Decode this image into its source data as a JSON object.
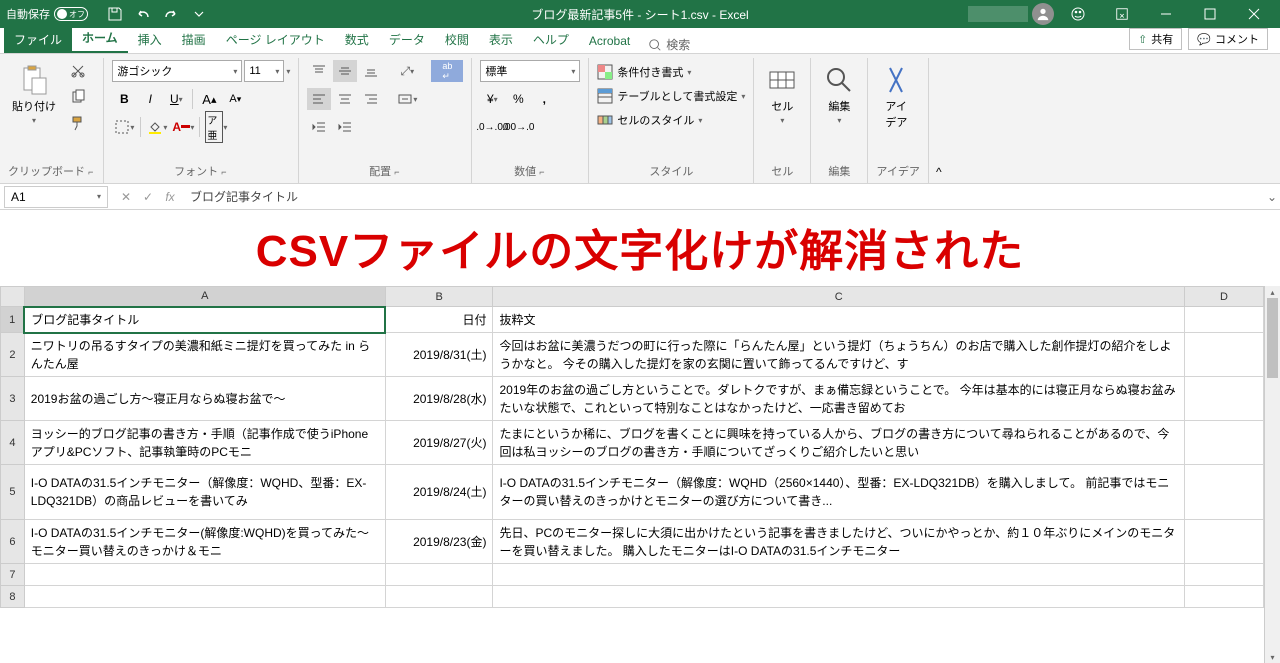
{
  "titlebar": {
    "autosave_label": "自動保存",
    "autosave_state": "オフ",
    "title": "ブログ最新記事5件 - シート1.csv - Excel"
  },
  "tabs": {
    "file": "ファイル",
    "home": "ホーム",
    "insert": "挿入",
    "draw": "描画",
    "pagelayout": "ページ レイアウト",
    "formulas": "数式",
    "data": "データ",
    "review": "校閲",
    "view": "表示",
    "help": "ヘルプ",
    "acrobat": "Acrobat",
    "tellme": "検索",
    "share": "共有",
    "comments": "コメント"
  },
  "ribbon": {
    "clipboard": {
      "paste": "貼り付け",
      "label": "クリップボード"
    },
    "font": {
      "name": "游ゴシック",
      "size": "11",
      "label": "フォント",
      "bold": "B",
      "italic": "I",
      "underline": "U"
    },
    "alignment": {
      "label": "配置"
    },
    "number": {
      "format": "標準",
      "label": "数値"
    },
    "styles": {
      "conditional": "条件付き書式",
      "table": "テーブルとして書式設定",
      "cell": "セルのスタイル",
      "label": "スタイル"
    },
    "cells": {
      "cell": "セル",
      "label": "セル"
    },
    "editing": {
      "edit": "編集",
      "label": "編集"
    },
    "ideas": {
      "ideas": "アイ\nデア",
      "label": "アイデア"
    }
  },
  "namebox": {
    "ref": "A1",
    "formula": "ブログ記事タイトル"
  },
  "overlay": "CSVファイルの文字化けが解消された",
  "columns": [
    "A",
    "B",
    "C",
    "D"
  ],
  "rows": [
    {
      "n": 1,
      "A": "ブログ記事タイトル",
      "B": "日付",
      "C": "抜粋文"
    },
    {
      "n": 2,
      "A": "ニワトリの吊るすタイプの美濃和紙ミニ提灯を買ってみた in らんたん屋",
      "B": "2019/8/31(土)",
      "C": "今回はお盆に美濃うだつの町に行った際に「らんたん屋」という提灯（ちょうちん）のお店で購入した創作提灯の紹介をしようかなと。 今その購入した提灯を家の玄関に置いて飾ってるんですけど、す"
    },
    {
      "n": 3,
      "A": "2019お盆の過ごし方～寝正月ならぬ寝お盆で～",
      "B": "2019/8/28(水)",
      "C": "2019年のお盆の過ごし方ということで。ダレトクですが、まぁ備忘録ということで。 今年は基本的には寝正月ならぬ寝お盆みたいな状態で、これといって特別なことはなかったけど、一応書き留めてお"
    },
    {
      "n": 4,
      "A": "ヨッシー的ブログ記事の書き方・手順（記事作成で使うiPhoneアプリ&PCソフト、記事執筆時のPCモニ",
      "B": "2019/8/27(火)",
      "C": "たまにというか稀に、ブログを書くことに興味を持っている人から、ブログの書き方について尋ねられることがあるので、今回は私ヨッシーのブログの書き方・手順についてざっくりご紹介したいと思い"
    },
    {
      "n": 5,
      "A": "I-O DATAの31.5インチモニター（解像度：WQHD、型番：EX-LDQ321DB）の商品レビューを書いてみ",
      "B": "2019/8/24(土)",
      "C": "I-O DATAの31.5インチモニター（解像度：WQHD（2560×1440）、型番：EX-LDQ321DB）を購入しまして。 前記事ではモニターの買い替えのきっかけとモニターの選び方について書き..."
    },
    {
      "n": 6,
      "A": "I-O DATAの31.5インチモニター(解像度:WQHD)を買ってみた～モニター買い替えのきっかけ＆モニ",
      "B": "2019/8/23(金)",
      "C": "先日、PCのモニター探しに大須に出かけたという記事を書きましたけど、ついにかやっとか、約１０年ぶりにメインのモニターを買い替えました。 購入したモニターはI-O DATAの31.5インチモニター"
    },
    {
      "n": 7,
      "A": "",
      "B": "",
      "C": ""
    },
    {
      "n": 8,
      "A": "",
      "B": "",
      "C": ""
    }
  ]
}
